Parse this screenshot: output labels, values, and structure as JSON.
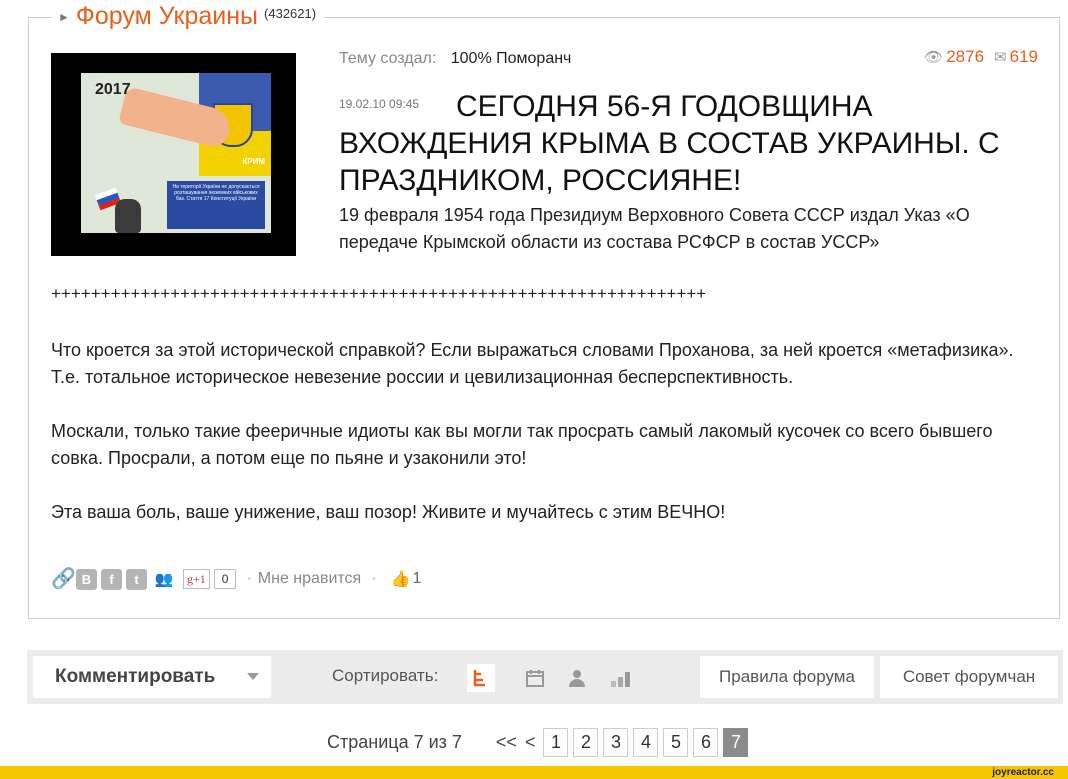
{
  "forum": {
    "title": "Форум Украины",
    "count": "(432621)"
  },
  "post": {
    "author_label": "Тему создал:",
    "author_name": "100% Поморанч",
    "views": "2876",
    "comments": "619",
    "date": "19.02.10 09:45",
    "title": "СЕГОДНЯ 56-Я ГОДОВЩИНА ВХОЖДЕНИЯ КРЫМА В СОСТАВ УКРАИНЫ. С ПРАЗДНИКОМ, РОССИЯНЕ!",
    "lead": "19 февраля 1954 года Президиум Верховного Совета СССР издал Указ «О передаче Крымской области из состава РСФСР в состав УССР»",
    "separator": "++++++++++++++++++++++++++++++++++++++++++++++++++++++++++++++++++",
    "paragraphs": [
      "Что кроется за этой исторической справкой? Если выражаться словами Проханова, за ней кроется «метафизика». Т.е. тотальное историческое невезение россии и цевилизационная бесперспективность.",
      "Москали, только такие фееричные идиоты как вы могли так просрать самый лакомый кусочек со всего бывшего совка. Просрали, а потом еще по пьяне и узаконили это!",
      "Эта ваша боль, ваше унижение, ваш позор! Живите и мучайтесь с этим ВЕЧНО!"
    ],
    "image": {
      "year": "2017",
      "region": "КРИМ",
      "sign_text": "На території України не допускається розташування іноземних військових баз. Стаття 17 Конституції України"
    },
    "share": {
      "vk": "В",
      "fb": "f",
      "tw": "t",
      "gplus": "g+1",
      "gplus_count": "0",
      "likes_label": "Мне нравится",
      "likes_count": "1"
    }
  },
  "toolbar": {
    "comment_label": "Комментировать",
    "sort_label": "Сортировать:",
    "rules_label": "Правила форума",
    "advice_label": "Совет форумчан",
    "sort_icons": [
      "tree-sort-icon",
      "calendar-icon",
      "user-icon",
      "rating-bars-icon"
    ]
  },
  "pagination": {
    "label": "Страница 7 из 7",
    "first": "<<",
    "prev": "<",
    "pages": [
      "1",
      "2",
      "3",
      "4",
      "5",
      "6",
      "7"
    ],
    "current": "7"
  },
  "footer": {
    "logo": "joyreactor.cc"
  },
  "colors": {
    "accent": "#e8601c",
    "footer": "#f6c500",
    "toolbar": "#ececec"
  }
}
